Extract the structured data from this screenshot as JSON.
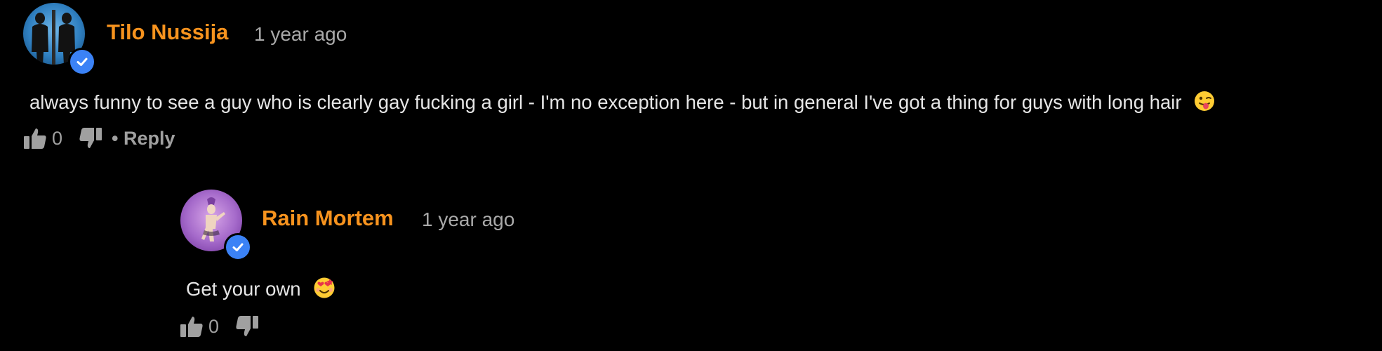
{
  "comments": [
    {
      "author": "Tilo Nussija",
      "timestamp": "1 year ago",
      "text": "always funny to see a guy who is clearly gay fucking a girl - I'm no exception here - but in general I've got a thing for guys with long hair",
      "emoji": "tongue-out-emoji",
      "likes": "0",
      "reply_label": "Reply",
      "reply_separator": "•",
      "verified": true
    },
    {
      "author": "Rain Mortem",
      "timestamp": "1 year ago",
      "text": "Get your own",
      "emoji": "heart-eyes-emoji",
      "likes": "0",
      "verified": true
    }
  ],
  "colors": {
    "background": "#000000",
    "username": "#f7931e",
    "timestamp": "#a9a9a9",
    "text": "#e6e6e6",
    "actions": "#a0a0a0",
    "verified_badge": "#3b82f6"
  }
}
